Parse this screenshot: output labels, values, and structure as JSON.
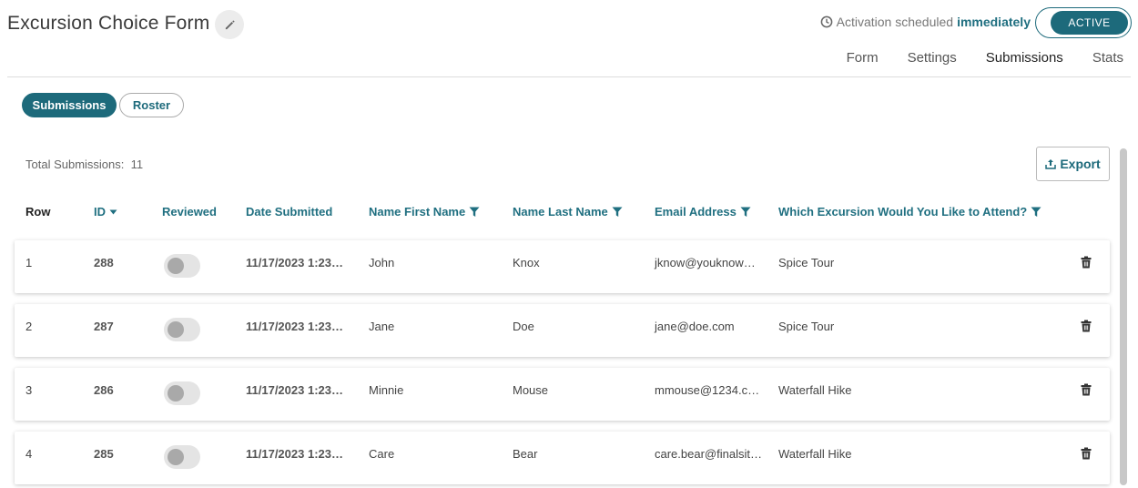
{
  "header": {
    "title": "Excursion Choice Form",
    "activation_prefix": "Activation scheduled",
    "activation_value": "immediately",
    "status_label": "ACTIVE"
  },
  "tabs": [
    {
      "label": "Form",
      "active": false
    },
    {
      "label": "Settings",
      "active": false
    },
    {
      "label": "Submissions",
      "active": true
    },
    {
      "label": "Stats",
      "active": false
    }
  ],
  "view_toggle": {
    "submissions_label": "Submissions",
    "roster_label": "Roster",
    "selected": "Submissions"
  },
  "summary": {
    "total_label": "Total Submissions:",
    "total_value": "11"
  },
  "export_label": "Export",
  "columns": {
    "row": "Row",
    "id": "ID",
    "reviewed": "Reviewed",
    "date": "Date Submitted",
    "first_name": "Name First Name",
    "last_name": "Name Last Name",
    "email": "Email Address",
    "excursion": "Which Excursion Would You Like to Attend?"
  },
  "rows": [
    {
      "row": "1",
      "id": "288",
      "reviewed": false,
      "date": "11/17/2023 1:23…",
      "first": "John",
      "last": "Knox",
      "email": "jknow@youknow…",
      "excursion": "Spice Tour"
    },
    {
      "row": "2",
      "id": "287",
      "reviewed": false,
      "date": "11/17/2023 1:23…",
      "first": "Jane",
      "last": "Doe",
      "email": "jane@doe.com",
      "excursion": "Spice Tour"
    },
    {
      "row": "3",
      "id": "286",
      "reviewed": false,
      "date": "11/17/2023 1:23…",
      "first": "Minnie",
      "last": "Mouse",
      "email": "mmouse@1234.c…",
      "excursion": "Waterfall Hike"
    },
    {
      "row": "4",
      "id": "285",
      "reviewed": false,
      "date": "11/17/2023 1:23…",
      "first": "Care",
      "last": "Bear",
      "email": "care.bear@finalsit…",
      "excursion": "Waterfall Hike"
    }
  ],
  "icons": {
    "edit": "pencil-icon",
    "clock": "clock-icon",
    "export": "upload-icon",
    "sort": "caret-down-icon",
    "filter": "filter-icon",
    "delete": "trash-icon"
  },
  "colors": {
    "accent": "#1d6a7b",
    "toggle_off": "#e4e4e4"
  }
}
